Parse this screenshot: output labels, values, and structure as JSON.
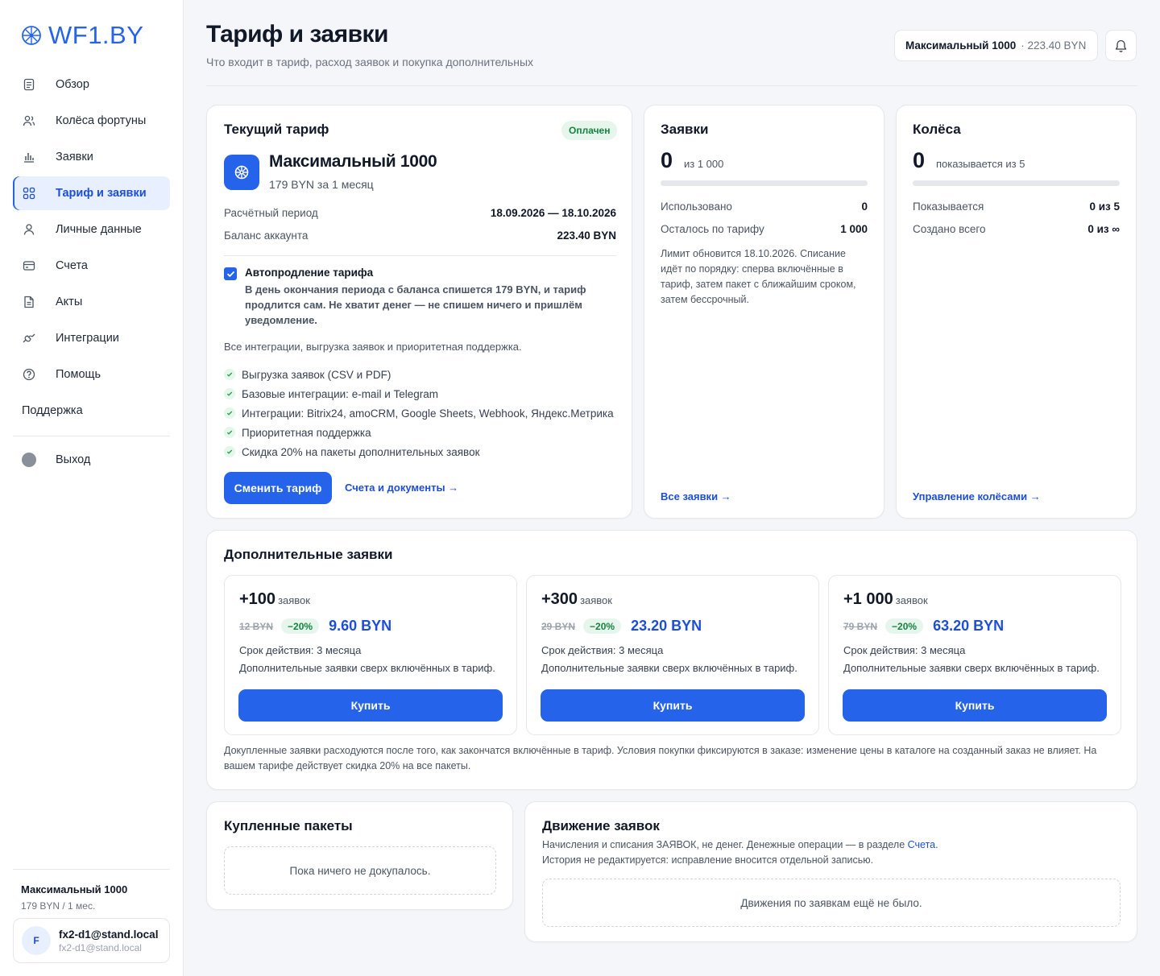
{
  "brand": {
    "name": "WF1.BY",
    "accent": "#2563eb"
  },
  "sidebar": {
    "items": [
      {
        "label": "Обзор",
        "icon": "document-icon"
      },
      {
        "label": "Колёса фортуны",
        "icon": "users-icon"
      },
      {
        "label": "Заявки",
        "icon": "bar-chart-icon"
      },
      {
        "label": "Тариф и заявки",
        "icon": "grid-icon",
        "active": true
      },
      {
        "label": "Личные данные",
        "icon": "user-icon"
      },
      {
        "label": "Счета",
        "icon": "card-icon"
      },
      {
        "label": "Акты",
        "icon": "file-icon"
      },
      {
        "label": "Интеграции",
        "icon": "plug-icon"
      },
      {
        "label": "Помощь",
        "icon": "help-icon"
      }
    ],
    "support_label": "Поддержка",
    "exit_label": "Выход",
    "plan_name": "Максимальный 1000",
    "plan_price": "179 BYN / 1 мес.",
    "user": {
      "initial": "F",
      "email": "fx2-d1@stand.local",
      "sub": "fx2-d1@stand.local"
    }
  },
  "header": {
    "title": "Тариф и заявки",
    "subtitle": "Что входит в тариф, расход заявок и покупка дополнительных",
    "pill_plan": "Максимальный 1000",
    "pill_amount": "· 223.40 BYN"
  },
  "tariff": {
    "title": "Текущий тариф",
    "status": "Оплачен",
    "plan_name": "Максимальный 1000",
    "plan_price": "179 BYN за 1 месяц",
    "period_label": "Расчётный период",
    "period_value": "18.09.2026 — 18.10.2026",
    "balance_label": "Баланс аккаунта",
    "balance_value": "223.40 BYN",
    "autorenew_checked": true,
    "autorenew_title": "Автопродление тарифа",
    "autorenew_desc": "В день окончания периода с баланса спишется 179 BYN, и тариф продлится сам. Не хватит денег — не спишем ничего и пришлём уведомление.",
    "summary": "Все интеграции, выгрузка заявок и приоритетная поддержка.",
    "features": [
      "Выгрузка заявок (CSV и PDF)",
      "Базовые интеграции: e-mail и Telegram",
      "Интеграции: Bitrix24, amoCRM, Google Sheets, Webhook, Яндекс.Метрика",
      "Приоритетная поддержка",
      "Скидка 20% на пакеты дополнительных заявок"
    ],
    "change_button": "Сменить тариф",
    "docs_link": "Счета и документы →"
  },
  "requests": {
    "title": "Заявки",
    "count": "0",
    "of": "из 1 000",
    "progress": 0,
    "used_label": "Использовано",
    "used_value": "0",
    "left_label": "Осталось по тарифу",
    "left_value": "1 000",
    "note": "Лимит обновится 18.10.2026. Списание идёт по порядку: сперва включённые в тариф, затем пакет с ближайшим сроком, затем бессрочный.",
    "link": "Все заявки →"
  },
  "wheels": {
    "title": "Колёса",
    "count": "0",
    "of": "показывается из 5",
    "progress": 0,
    "shown_label": "Показывается",
    "shown_value": "0 из 5",
    "created_label": "Создано всего",
    "created_value": "0 из ∞",
    "link": "Управление колёсами →"
  },
  "extra": {
    "title": "Дополнительные заявки",
    "packages": [
      {
        "count": "+100",
        "unit": "заявок",
        "old_price": "12 BYN",
        "discount": "−20%",
        "price": "9.60 BYN",
        "term": "Срок действия: 3 месяца",
        "desc": "Дополнительные заявки сверх включённых в тариф.",
        "buy": "Купить"
      },
      {
        "count": "+300",
        "unit": "заявок",
        "old_price": "29 BYN",
        "discount": "−20%",
        "price": "23.20 BYN",
        "term": "Срок действия: 3 месяца",
        "desc": "Дополнительные заявки сверх включённых в тариф.",
        "buy": "Купить"
      },
      {
        "count": "+1 000",
        "unit": "заявок",
        "old_price": "79 BYN",
        "discount": "−20%",
        "price": "63.20 BYN",
        "term": "Срок действия: 3 месяца",
        "desc": "Дополнительные заявки сверх включённых в тариф.",
        "buy": "Купить"
      }
    ],
    "note": "Докупленные заявки расходуются после того, как закончатся включённые в тариф. Условия покупки фиксируются в заказе: изменение цены в каталоге на созданный заказ не влияет. На вашем тарифе действует скидка 20% на все пакеты."
  },
  "bought": {
    "title": "Купленные пакеты",
    "empty": "Пока ничего не докупалось."
  },
  "moves": {
    "title": "Движение заявок",
    "desc_line1": "Начисления и списания ЗАЯВОК, не денег. Денежные операции — в разделе ",
    "desc_link": "Счета",
    "desc_line1_end": ".",
    "desc_line2": "История не редактируется: исправление вносится отдельной записью.",
    "empty": "Движения по заявкам ещё не было."
  }
}
